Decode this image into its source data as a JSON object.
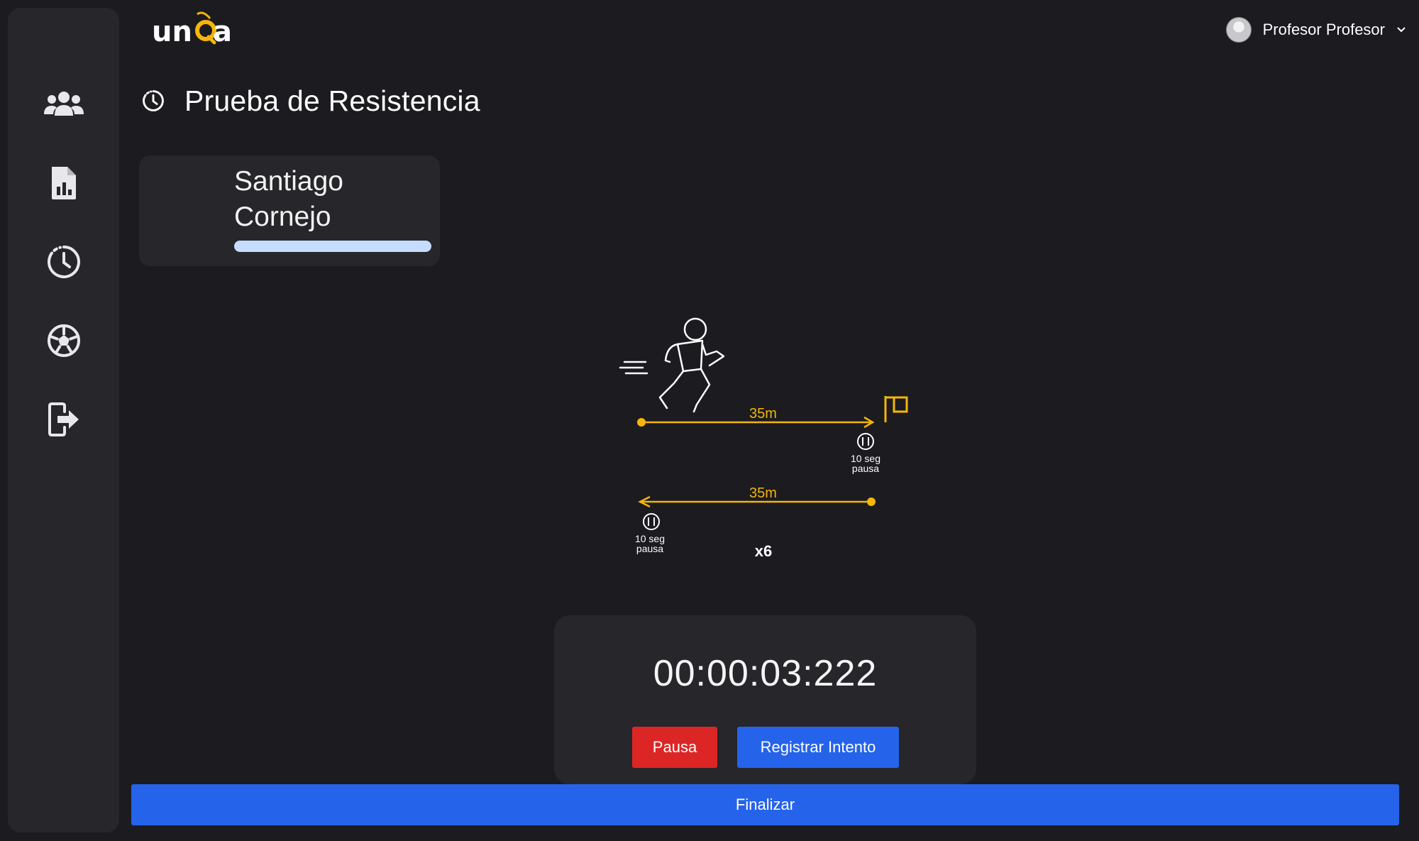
{
  "brand": {
    "logo_text": "unqa",
    "accent_color": "#f5b50a"
  },
  "header": {
    "user_name": "Profesor Profesor",
    "avatar_icon": "user-avatar",
    "menu_icon": "chevron-down-icon"
  },
  "sidebar": {
    "items": [
      {
        "name": "students",
        "icon": "users-icon"
      },
      {
        "name": "reports",
        "icon": "report-chart-icon"
      },
      {
        "name": "history",
        "icon": "clock-history-icon"
      },
      {
        "name": "sports",
        "icon": "soccer-ball-icon"
      },
      {
        "name": "logout",
        "icon": "logout-icon"
      }
    ]
  },
  "page": {
    "title": "Prueba de Resistencia",
    "title_icon": "clock-history-icon"
  },
  "student": {
    "name": "Santiago Cornejo",
    "progress": 1.0
  },
  "diagram": {
    "forward_distance": "35m",
    "return_distance": "35m",
    "pause_forward_line1": "10 seg",
    "pause_forward_line2": "pausa",
    "pause_return_line1": "10 seg",
    "pause_return_line2": "pausa",
    "repetitions": "x6"
  },
  "timer": {
    "value": "00:00:03:222",
    "pause_label": "Pausa",
    "register_label": "Registrar Intento"
  },
  "footer": {
    "finish_label": "Finalizar"
  },
  "colors": {
    "background": "#1b1b20",
    "card": "#26262b",
    "primary": "#2563eb",
    "danger": "#dc2626",
    "progress": "#c6dcff"
  }
}
